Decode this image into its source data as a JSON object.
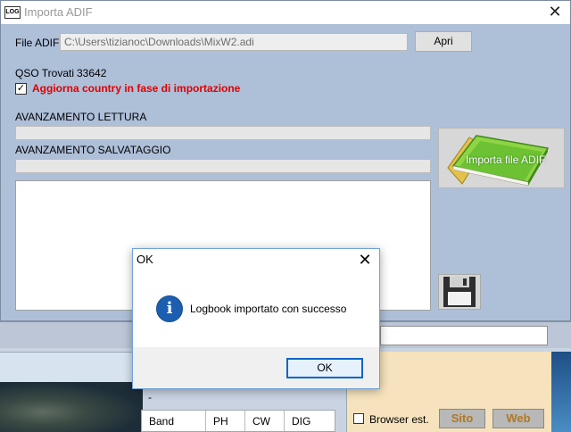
{
  "window": {
    "title": "Importa ADIF",
    "icon_text": "LOG",
    "close_glyph": "✕"
  },
  "form": {
    "file_label": "File ADIF",
    "file_value": "C:\\Users\\tizianoc\\Downloads\\MixW2.adi",
    "open_button": "Apri",
    "qso_label": "QSO Trovati",
    "qso_count": "33642",
    "country_checkbox_label": "Aggiorna country in fase di importazione",
    "country_checked": true,
    "read_progress_label": "AVANZAMENTO LETTURA",
    "save_progress_label": "AVANZAMENTO SALVATAGGIO",
    "import_button": "Importa file ADIF"
  },
  "dialog": {
    "title": "OK",
    "message": "Logbook importato con successo",
    "ok_button": "OK",
    "close_glyph": "✕",
    "icon_glyph": "i"
  },
  "background": {
    "dash": "-",
    "table_headers": [
      "Band",
      "PH",
      "CW",
      "DIG"
    ],
    "browser_label": "Browser est.",
    "sito_button": "Sito",
    "web_button": "Web"
  },
  "colors": {
    "accent_red": "#e00000",
    "dialog_border": "#0a64c8",
    "info_blue": "#1c5fb0"
  },
  "icons": [
    "app-logo-icon",
    "close-icon",
    "checkmark-icon",
    "green-book-icon",
    "floppy-disk-icon",
    "info-icon"
  ]
}
